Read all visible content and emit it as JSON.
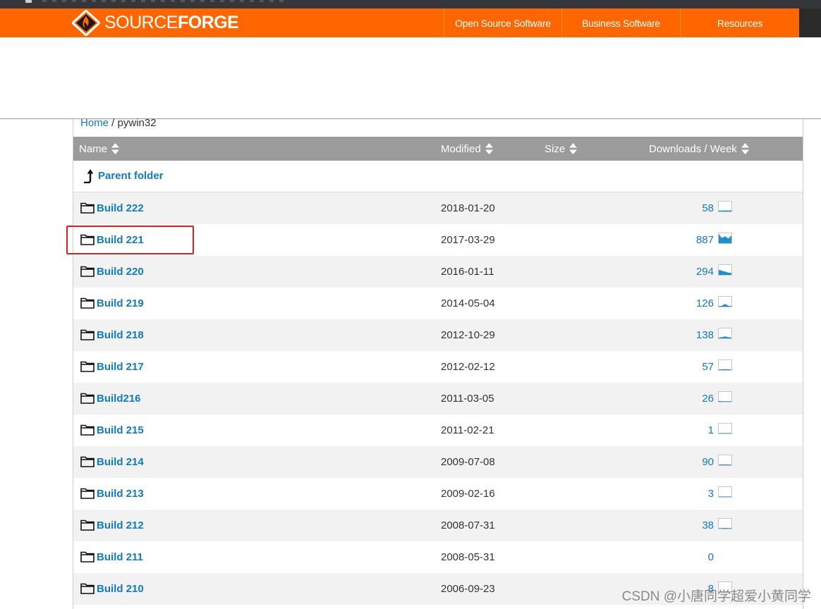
{
  "header": {
    "logo_light": "SOURCE",
    "logo_bold": "FORGE",
    "nav": [
      "Open Source Software",
      "Business Software",
      "Resources"
    ]
  },
  "breadcrumb": {
    "home": "Home",
    "separator": " / ",
    "current": "pywin32"
  },
  "table": {
    "columns": [
      "Name",
      "Modified",
      "Size",
      "Downloads / Week"
    ],
    "parent_label": "Parent folder",
    "rows": [
      {
        "name": "Build 222",
        "modified": "2018-01-20",
        "downloads": "58",
        "spark": [
          0.1,
          0.1,
          0.12,
          0.1,
          0.12
        ]
      },
      {
        "name": "Build 221",
        "modified": "2017-03-29",
        "downloads": "887",
        "spark": [
          1.0,
          0.55,
          0.75,
          0.5,
          0.85
        ]
      },
      {
        "name": "Build 220",
        "modified": "2016-01-11",
        "downloads": "294",
        "spark": [
          0.55,
          0.45,
          0.35,
          0.25,
          0.2
        ]
      },
      {
        "name": "Build 219",
        "modified": "2014-05-04",
        "downloads": "126",
        "spark": [
          0.05,
          0.1,
          0.3,
          0.1,
          0.05
        ]
      },
      {
        "name": "Build 218",
        "modified": "2012-10-29",
        "downloads": "138",
        "spark": [
          0.08,
          0.12,
          0.2,
          0.12,
          0.08
        ]
      },
      {
        "name": "Build 217",
        "modified": "2012-02-12",
        "downloads": "57",
        "spark": [
          0.05,
          0.08,
          0.1,
          0.08,
          0.05
        ]
      },
      {
        "name": "Build216",
        "modified": "2011-03-05",
        "downloads": "26",
        "spark": [
          0.1,
          0.05,
          0.05,
          0.05,
          0.05
        ]
      },
      {
        "name": "Build 215",
        "modified": "2011-02-21",
        "downloads": "1",
        "spark": [
          0,
          0,
          0,
          0,
          0
        ]
      },
      {
        "name": "Build 214",
        "modified": "2009-07-08",
        "downloads": "90",
        "spark": [
          0.05,
          0.08,
          0.08,
          0.08,
          0.05
        ]
      },
      {
        "name": "Build 213",
        "modified": "2009-02-16",
        "downloads": "3",
        "spark": [
          0,
          0,
          0,
          0,
          0
        ]
      },
      {
        "name": "Build 212",
        "modified": "2008-07-31",
        "downloads": "38",
        "spark": [
          0.05,
          0.05,
          0.08,
          0.05,
          0.05
        ]
      },
      {
        "name": "Build 211",
        "modified": "2008-05-31",
        "downloads": "0",
        "spark": null
      },
      {
        "name": "Build 210",
        "modified": "2006-09-23",
        "downloads": "8",
        "spark": [
          0,
          0,
          0,
          0,
          0
        ]
      }
    ]
  },
  "watermark": "CSDN @小唐同学超爱小黄同学",
  "colors": {
    "brand_orange": "#ff6600",
    "link_blue": "#0e7bc2",
    "header_gray": "#9b9b9b",
    "highlight_red": "#e02020"
  }
}
